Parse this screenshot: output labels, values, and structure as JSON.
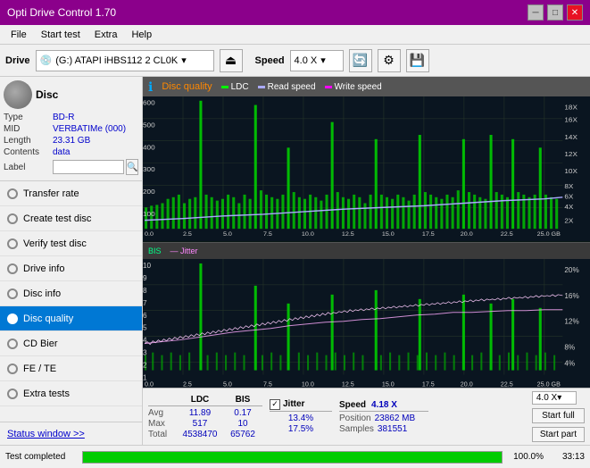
{
  "app": {
    "title": "Opti Drive Control 1.70",
    "window_controls": [
      "minimize",
      "maximize",
      "close"
    ]
  },
  "menu": {
    "items": [
      "File",
      "Start test",
      "Extra",
      "Help"
    ]
  },
  "toolbar": {
    "drive_label": "Drive",
    "drive_value": "(G:) ATAPI iHBS112  2 CL0K",
    "speed_label": "Speed",
    "speed_value": "4.0 X"
  },
  "disc": {
    "title": "Disc",
    "type_label": "Type",
    "type_value": "BD-R",
    "mid_label": "MID",
    "mid_value": "VERBATIMe (000)",
    "length_label": "Length",
    "length_value": "23.31 GB",
    "contents_label": "Contents",
    "contents_value": "data",
    "label_label": "Label"
  },
  "nav": {
    "items": [
      {
        "id": "transfer-rate",
        "label": "Transfer rate",
        "active": false
      },
      {
        "id": "create-test-disc",
        "label": "Create test disc",
        "active": false
      },
      {
        "id": "verify-test-disc",
        "label": "Verify test disc",
        "active": false
      },
      {
        "id": "drive-info",
        "label": "Drive info",
        "active": false
      },
      {
        "id": "disc-info",
        "label": "Disc info",
        "active": false
      },
      {
        "id": "disc-quality",
        "label": "Disc quality",
        "active": true
      },
      {
        "id": "cd-bier",
        "label": "CD Bier",
        "active": false
      },
      {
        "id": "fe-te",
        "label": "FE / TE",
        "active": false
      },
      {
        "id": "extra-tests",
        "label": "Extra tests",
        "active": false
      }
    ],
    "status_link": "Status window >>"
  },
  "chart": {
    "title": "Disc quality",
    "legend": {
      "ldc": "LDC",
      "read_speed": "Read speed",
      "write_speed": "Write speed"
    },
    "upper": {
      "y_max": 600,
      "y_right_labels": [
        "18X",
        "16X",
        "14X",
        "12X",
        "10X",
        "8X",
        "6X",
        "4X",
        "2X"
      ],
      "x_labels": [
        "0.0",
        "2.5",
        "5.0",
        "7.5",
        "10.0",
        "12.5",
        "15.0",
        "17.5",
        "20.0",
        "22.5",
        "25.0 GB"
      ]
    },
    "lower": {
      "title": "BIS",
      "legend2": "Jitter",
      "y_max": 10,
      "y_right_labels": [
        "20%",
        "16%",
        "12%",
        "8%",
        "4%"
      ],
      "x_labels": [
        "0.0",
        "2.5",
        "5.0",
        "7.5",
        "10.0",
        "12.5",
        "15.0",
        "17.5",
        "20.0",
        "22.5",
        "25.0 GB"
      ]
    }
  },
  "stats": {
    "columns": [
      "LDC",
      "BIS"
    ],
    "rows": [
      {
        "label": "Avg",
        "ldc": "11.89",
        "bis": "0.17"
      },
      {
        "label": "Max",
        "ldc": "517",
        "bis": "10"
      },
      {
        "label": "Total",
        "ldc": "4538470",
        "bis": "65762"
      }
    ],
    "jitter": {
      "label": "Jitter",
      "avg": "13.4%",
      "max": "17.5%",
      "checked": true
    },
    "speed": {
      "label": "Speed",
      "value": "4.18 X",
      "selector": "4.0 X"
    },
    "position": {
      "label": "Position",
      "value": "23862 MB"
    },
    "samples": {
      "label": "Samples",
      "value": "381551"
    },
    "buttons": {
      "start_full": "Start full",
      "start_part": "Start part"
    }
  },
  "progress": {
    "status": "Test completed",
    "percent": 100.0,
    "percent_display": "100.0%",
    "time": "33:13"
  }
}
